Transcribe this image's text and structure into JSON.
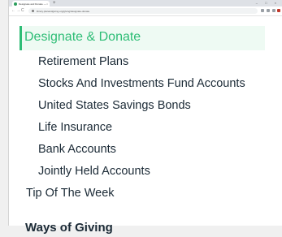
{
  "browser": {
    "tab_title": "Designate and Donate — Ama",
    "tab_close": "×",
    "new_tab": "+",
    "window_controls": "– □ ×",
    "back_icon": "←",
    "forward_icon": "→",
    "reload_icon": "C",
    "url": "library.planandgiving.org/giving/designate-donate"
  },
  "nav": {
    "active": "Designate & Donate",
    "subitems": [
      "Retirement Plans",
      "Stocks And Investments Fund Accounts",
      "United States Savings Bonds",
      "Life Insurance",
      "Bank Accounts",
      "Jointly Held Accounts"
    ],
    "tip": "Tip Of The Week",
    "next_section_partial": "Ways of Giving"
  },
  "colors": {
    "accent": "#2ebd76",
    "active_bg": "#eefaf3",
    "text": "#1b2a36"
  }
}
